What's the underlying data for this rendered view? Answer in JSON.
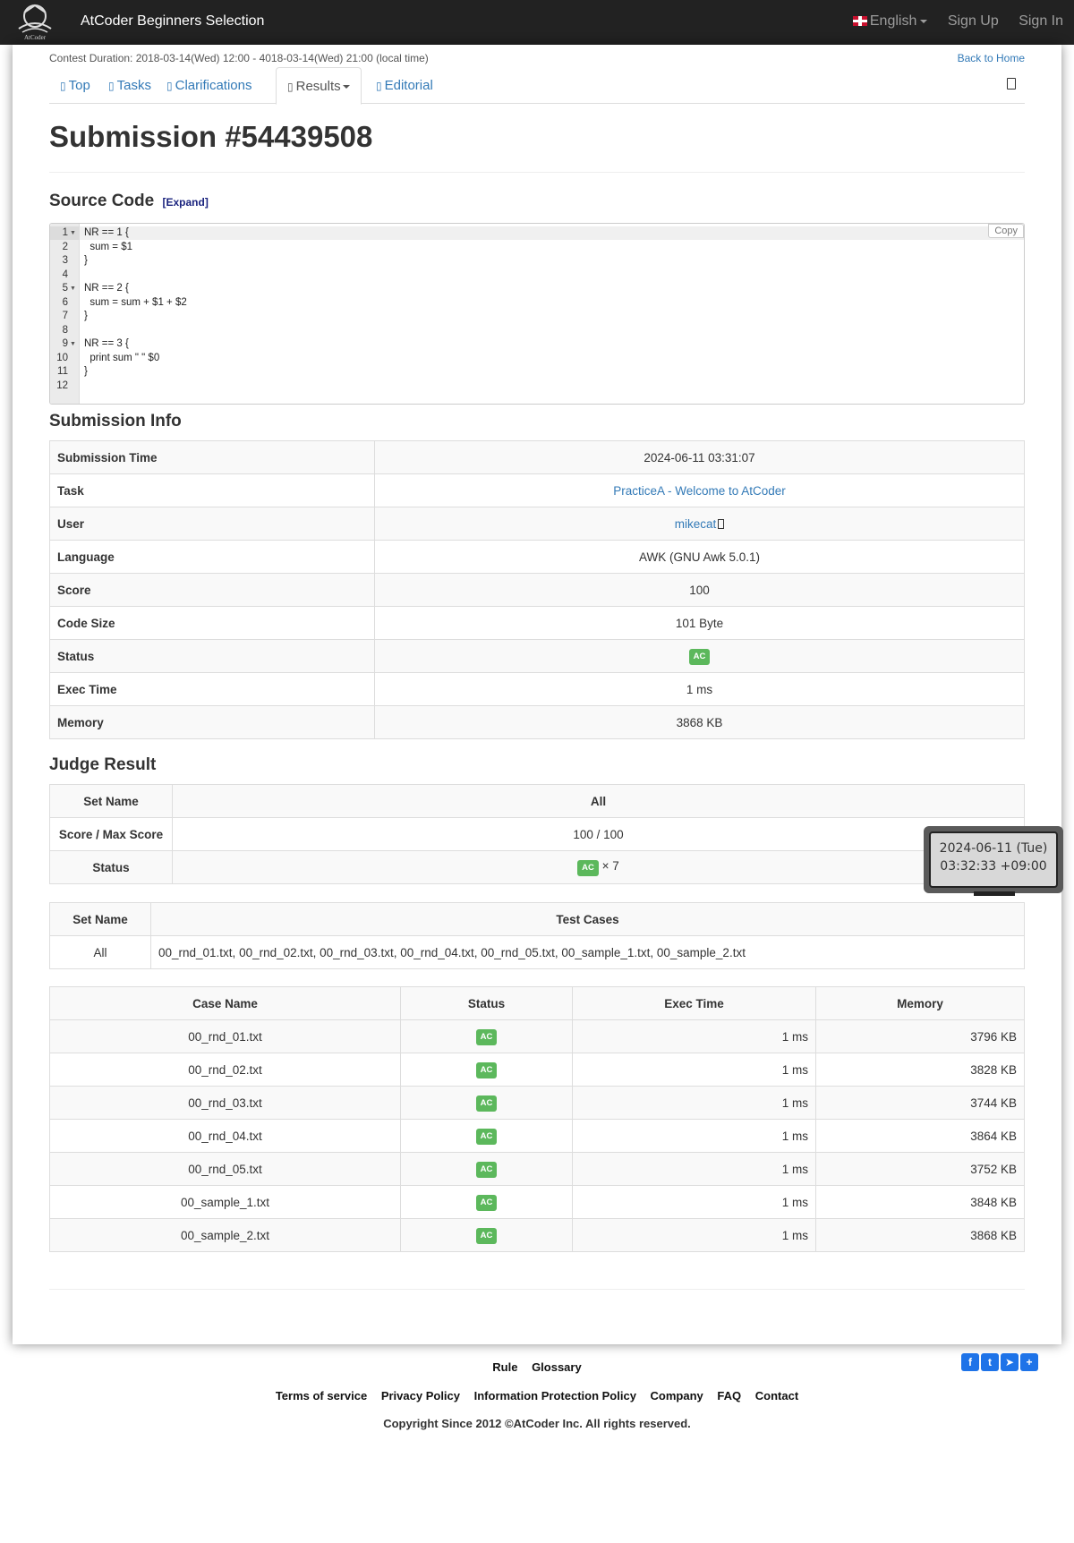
{
  "navbar": {
    "brand": "AtCoder Beginners Selection",
    "logo_text": "AtCoder",
    "language": "English",
    "sign_up": "Sign Up",
    "sign_in": "Sign In"
  },
  "contest": {
    "duration": "Contest Duration: 2018-03-14(Wed) 12:00 - 4018-03-14(Wed) 21:00 (local time)",
    "back_home": "Back to Home"
  },
  "tabs": [
    {
      "label": "Top",
      "icon": "home-icon"
    },
    {
      "label": "Tasks",
      "icon": "tasks-icon"
    },
    {
      "label": "Clarifications",
      "icon": "question-icon"
    },
    {
      "label": "Results",
      "icon": "list-icon"
    },
    {
      "label": "Editorial",
      "icon": "book-icon"
    }
  ],
  "page_title": "Submission #54439508",
  "source_code": {
    "heading": "Source Code",
    "expand": "[Expand]",
    "copy": "Copy",
    "lines": [
      {
        "n": "1",
        "fold": true,
        "text": "NR == 1 {"
      },
      {
        "n": "2",
        "fold": false,
        "text": "  sum = $1"
      },
      {
        "n": "3",
        "fold": false,
        "text": "}"
      },
      {
        "n": "4",
        "fold": false,
        "text": ""
      },
      {
        "n": "5",
        "fold": true,
        "text": "NR == 2 {"
      },
      {
        "n": "6",
        "fold": false,
        "text": "  sum = sum + $1 + $2"
      },
      {
        "n": "7",
        "fold": false,
        "text": "}"
      },
      {
        "n": "8",
        "fold": false,
        "text": ""
      },
      {
        "n": "9",
        "fold": true,
        "text": "NR == 3 {"
      },
      {
        "n": "10",
        "fold": false,
        "text": "  print sum \" \" $0"
      },
      {
        "n": "11",
        "fold": false,
        "text": "}"
      },
      {
        "n": "12",
        "fold": false,
        "text": ""
      }
    ]
  },
  "submission_info": {
    "heading": "Submission Info",
    "rows": {
      "submission_time": {
        "label": "Submission Time",
        "value": "2024-06-11 03:31:07"
      },
      "task": {
        "label": "Task",
        "value": "PracticeA - Welcome to AtCoder"
      },
      "user": {
        "label": "User",
        "value": "mikecat"
      },
      "language": {
        "label": "Language",
        "value": "AWK (GNU Awk 5.0.1)"
      },
      "score": {
        "label": "Score",
        "value": "100"
      },
      "code_size": {
        "label": "Code Size",
        "value": "101 Byte"
      },
      "status": {
        "label": "Status",
        "value": "AC"
      },
      "exec_time": {
        "label": "Exec Time",
        "value": "1 ms"
      },
      "memory": {
        "label": "Memory",
        "value": "3868 KB"
      }
    }
  },
  "judge_result": {
    "heading": "Judge Result",
    "summary": {
      "set_name_label": "Set Name",
      "set_name": "All",
      "score_label": "Score / Max Score",
      "score": "100 / 100",
      "status_label": "Status",
      "status": "AC",
      "count": "× 7"
    },
    "sets": {
      "set_name_header": "Set Name",
      "test_cases_header": "Test Cases",
      "set_name": "All",
      "test_cases": "00_rnd_01.txt, 00_rnd_02.txt, 00_rnd_03.txt, 00_rnd_04.txt, 00_rnd_05.txt, 00_sample_1.txt, 00_sample_2.txt"
    },
    "cases": {
      "headers": {
        "name": "Case Name",
        "status": "Status",
        "time": "Exec Time",
        "memory": "Memory"
      },
      "rows": [
        {
          "name": "00_rnd_01.txt",
          "status": "AC",
          "time": "1 ms",
          "memory": "3796 KB"
        },
        {
          "name": "00_rnd_02.txt",
          "status": "AC",
          "time": "1 ms",
          "memory": "3828 KB"
        },
        {
          "name": "00_rnd_03.txt",
          "status": "AC",
          "time": "1 ms",
          "memory": "3744 KB"
        },
        {
          "name": "00_rnd_04.txt",
          "status": "AC",
          "time": "1 ms",
          "memory": "3864 KB"
        },
        {
          "name": "00_rnd_05.txt",
          "status": "AC",
          "time": "1 ms",
          "memory": "3752 KB"
        },
        {
          "name": "00_sample_1.txt",
          "status": "AC",
          "time": "1 ms",
          "memory": "3848 KB"
        },
        {
          "name": "00_sample_2.txt",
          "status": "AC",
          "time": "1 ms",
          "memory": "3868 KB"
        }
      ]
    }
  },
  "tooltip": {
    "line1": "2024-06-11 (Tue)",
    "line2": "03:32:33 +09:00"
  },
  "share_icons": [
    "facebook-icon",
    "twitter-icon",
    "telegram-icon",
    "share-plus-icon"
  ],
  "footer": {
    "rule": "Rule",
    "glossary": "Glossary",
    "terms": "Terms of service",
    "privacy": "Privacy Policy",
    "info_protection": "Information Protection Policy",
    "company": "Company",
    "faq": "FAQ",
    "contact": "Contact",
    "copyright": "Copyright Since 2012 ©AtCoder Inc. All rights reserved."
  },
  "colors": {
    "navbar_bg": "#222222",
    "link": "#337ab7",
    "ac_label": "#5cb85c",
    "share_blue": "#1e73e8"
  }
}
